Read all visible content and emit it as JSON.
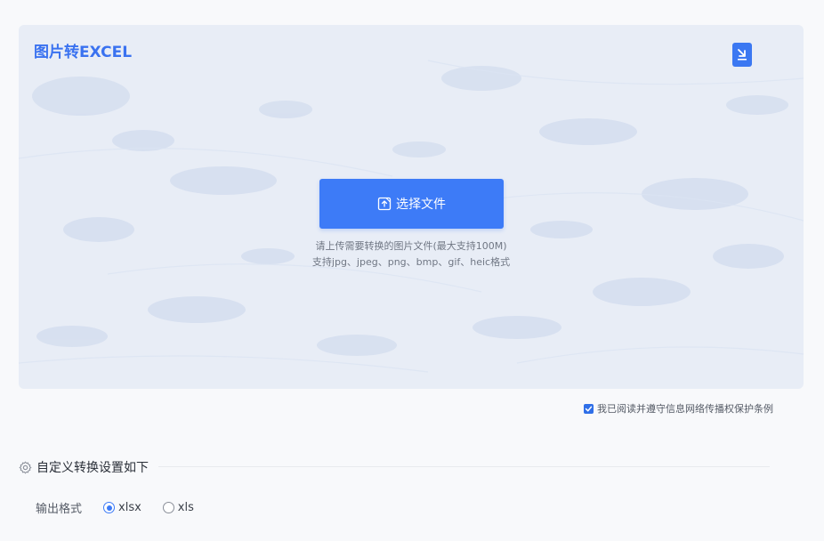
{
  "tool": {
    "title": "图片转EXCEL"
  },
  "upload": {
    "select_button_label": "选择文件",
    "hint_line1": "请上传需要转换的图片文件(最大支持100M)",
    "hint_line2": "支持jpg、jpeg、png、bmp、gif、heic格式",
    "download_icon": "download-icon",
    "select_icon": "file-upload-icon"
  },
  "agreement": {
    "checked": true,
    "label": "我已阅读并遵守信息网络传播权保护条例"
  },
  "settings": {
    "heading": "自定义转换设置如下",
    "icon": "gear-icon",
    "output_format": {
      "label": "输出格式",
      "options": [
        {
          "label": "xlsx",
          "selected": true
        },
        {
          "label": "xls",
          "selected": false
        }
      ]
    }
  },
  "colors": {
    "accent": "#3d7bf7",
    "panel_bg": "#e8edf6",
    "title": "#3a72f0"
  }
}
